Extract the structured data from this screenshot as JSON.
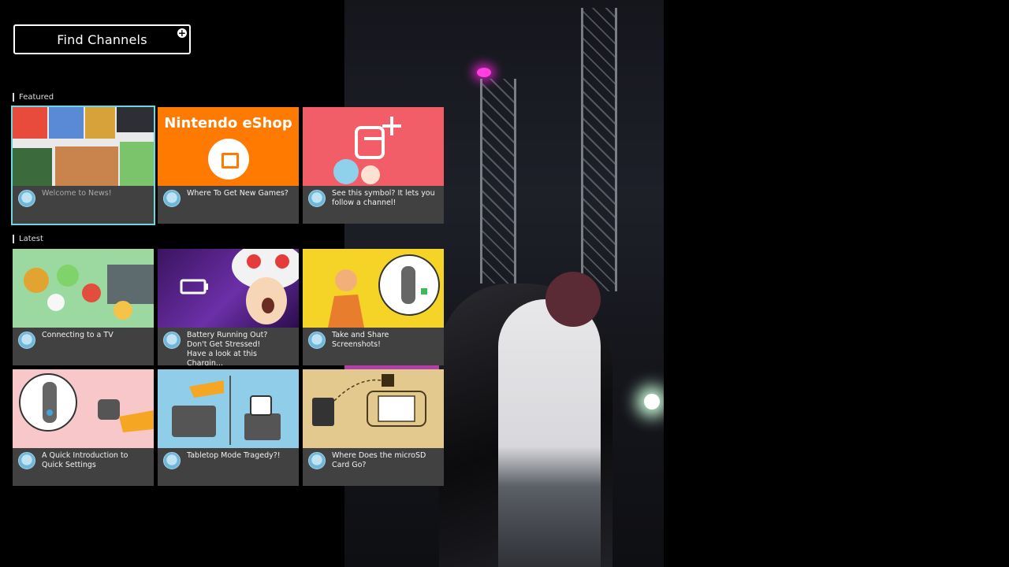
{
  "header": {
    "find_channels_label": "Find Channels",
    "plus_icon": "plus-circle-icon"
  },
  "sections": {
    "featured_label": "Featured",
    "latest_label": "Latest"
  },
  "featured": [
    {
      "title": "Welcome to News!",
      "thumb": "news-collage"
    },
    {
      "title": "Where To Get New Games?",
      "thumb": "eshop",
      "brand": "Nintendo eShop"
    },
    {
      "title": "See this symbol? It lets you follow a channel!",
      "thumb": "follow-symbol"
    }
  ],
  "latest": [
    {
      "title": "Connecting to a TV",
      "thumb": "characters-tv"
    },
    {
      "title": "Battery Running Out?\nDon't Get Stressed!\nHave a look at this Chargin...",
      "thumb": "battery-toad"
    },
    {
      "title": "Take and Share Screenshots!",
      "thumb": "screenshot-button"
    },
    {
      "title": "A Quick Introduction to Quick Settings",
      "thumb": "quick-settings"
    },
    {
      "title": "Tabletop Mode Tragedy?!",
      "thumb": "tabletop-mode"
    },
    {
      "title": "Where Does the microSD Card Go?",
      "thumb": "microsd-map"
    }
  ],
  "colors": {
    "selection_outline": "#6ad7e3",
    "card_meta_bg": "#414141",
    "eshop_orange": "#ff7a00"
  }
}
